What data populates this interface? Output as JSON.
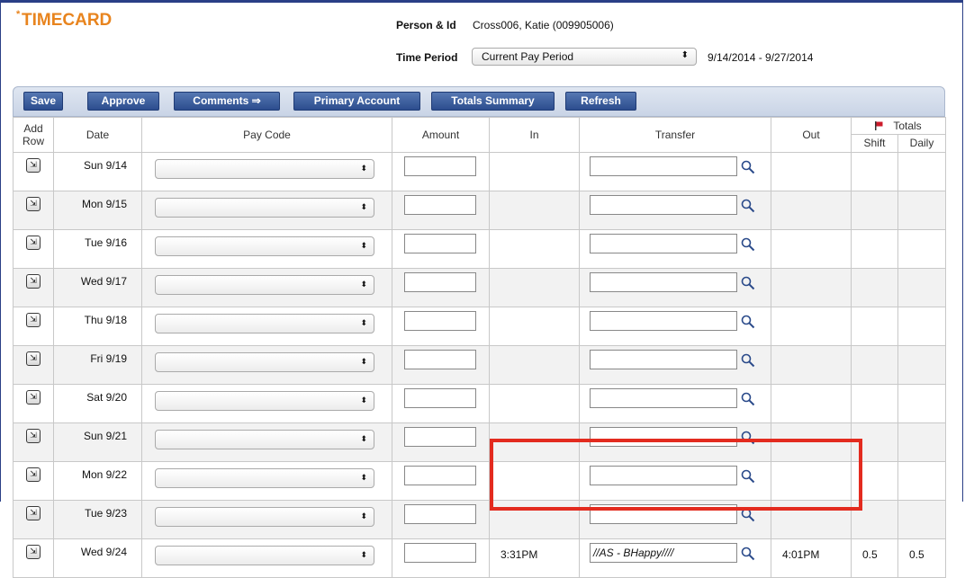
{
  "header": {
    "title": "TIMECARD",
    "title_marker": "*",
    "person_label": "Person & Id",
    "person_value": "Cross006, Katie (009905006)",
    "period_label": "Time Period",
    "period_selected": "Current Pay Period",
    "period_range": "9/14/2014 - 9/27/2014"
  },
  "toolbar": {
    "save": "Save",
    "approve": "Approve",
    "comments": "Comments ⇒",
    "primary_account": "Primary Account",
    "totals_summary": "Totals Summary",
    "refresh": "Refresh"
  },
  "columns": {
    "add": "Add",
    "row": "Row",
    "date": "Date",
    "pay_code": "Pay Code",
    "amount": "Amount",
    "in": "In",
    "transfer": "Transfer",
    "out": "Out",
    "totals": "Totals",
    "shift": "Shift",
    "daily": "Daily"
  },
  "rows": [
    {
      "date": "Sun 9/14",
      "in": "",
      "transfer": "",
      "out": "",
      "shift": "",
      "daily": ""
    },
    {
      "date": "Mon 9/15",
      "in": "",
      "transfer": "",
      "out": "",
      "shift": "",
      "daily": ""
    },
    {
      "date": "Tue 9/16",
      "in": "",
      "transfer": "",
      "out": "",
      "shift": "",
      "daily": ""
    },
    {
      "date": "Wed 9/17",
      "in": "",
      "transfer": "",
      "out": "",
      "shift": "",
      "daily": ""
    },
    {
      "date": "Thu 9/18",
      "in": "",
      "transfer": "",
      "out": "",
      "shift": "",
      "daily": ""
    },
    {
      "date": "Fri 9/19",
      "in": "",
      "transfer": "",
      "out": "",
      "shift": "",
      "daily": ""
    },
    {
      "date": "Sat 9/20",
      "in": "",
      "transfer": "",
      "out": "",
      "shift": "",
      "daily": ""
    },
    {
      "date": "Sun 9/21",
      "in": "",
      "transfer": "",
      "out": "",
      "shift": "",
      "daily": ""
    },
    {
      "date": "Mon 9/22",
      "in": "",
      "transfer": "",
      "out": "",
      "shift": "",
      "daily": ""
    },
    {
      "date": "Tue 9/23",
      "in": "",
      "transfer": "",
      "out": "",
      "shift": "",
      "daily": ""
    },
    {
      "date": "Wed 9/24",
      "in": "3:31PM",
      "transfer": "//AS - BHappy////",
      "out": "4:01PM",
      "shift": "0.5",
      "daily": "0.5"
    }
  ],
  "colors": {
    "title": "#e8841e",
    "button": "#2c4d8e",
    "highlight": "#e32b1f",
    "totals_flag": "#cc1b2b"
  }
}
